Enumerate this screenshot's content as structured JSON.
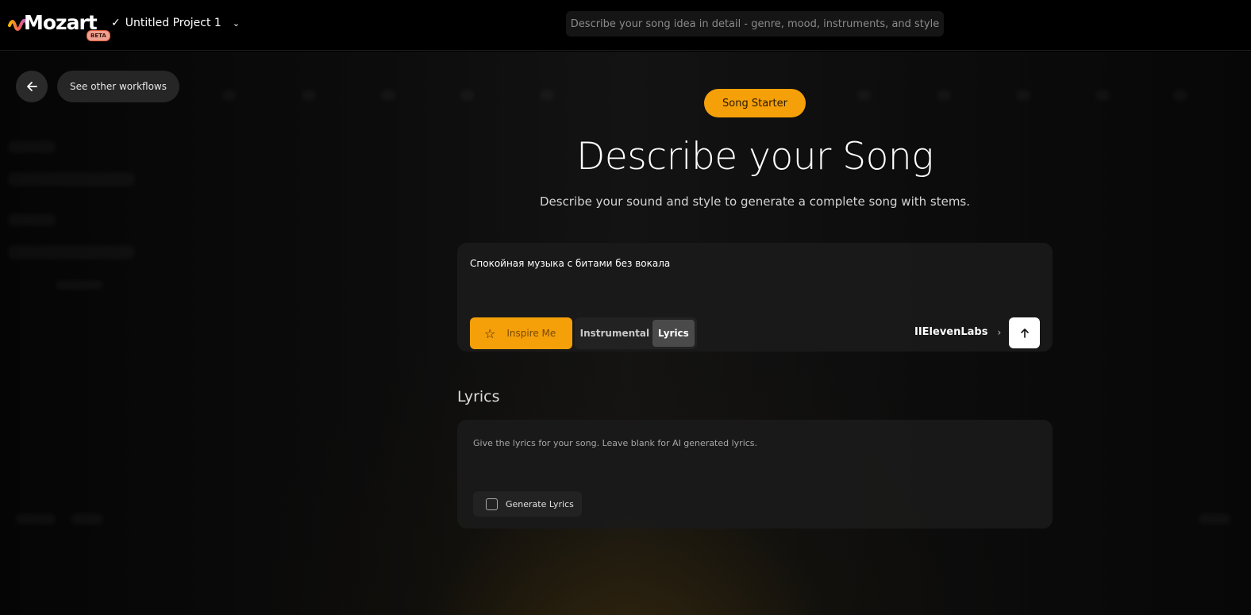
{
  "app": {
    "logo_text": "Mozart",
    "beta_badge": "BETA",
    "project_name": "Untitled Project 1",
    "search_placeholder": "Describe your song idea in detail - genre, mood, instruments, and style"
  },
  "nav": {
    "back_icon": "arrow-left-icon",
    "workflows_label": "See other workflows"
  },
  "hero": {
    "pill_label": "Song Starter",
    "title": "Describe your Song",
    "subtitle": "Describe your sound and style to generate a complete song with stems."
  },
  "prompt": {
    "text": "Спокойная музыка с битами без вокала",
    "inspire_label": "Inspire Me",
    "modes": [
      "Instrumental",
      "Lyrics"
    ],
    "selected_mode": "Lyrics",
    "provider_label": "IIElevenLabs"
  },
  "lyrics": {
    "heading": "Lyrics",
    "hint": "Give the lyrics for your song. Leave blank for AI generated lyrics.",
    "generate_label": "Generate Lyrics",
    "generate_checked": false
  },
  "colors": {
    "accent": "#f5a009",
    "background": "#000000",
    "card": "#1a1a1a"
  }
}
